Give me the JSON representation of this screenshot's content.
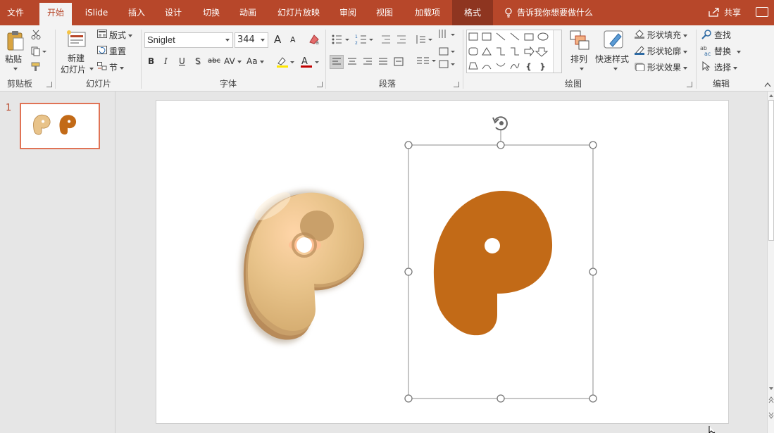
{
  "tabs": [
    {
      "label": "文件",
      "active": false
    },
    {
      "label": "开始",
      "active": true
    },
    {
      "label": "iSlide",
      "active": false
    },
    {
      "label": "插入",
      "active": false
    },
    {
      "label": "设计",
      "active": false
    },
    {
      "label": "切换",
      "active": false
    },
    {
      "label": "动画",
      "active": false
    },
    {
      "label": "幻灯片放映",
      "active": false
    },
    {
      "label": "审阅",
      "active": false
    },
    {
      "label": "视图",
      "active": false
    },
    {
      "label": "加载项",
      "active": false
    },
    {
      "label": "格式",
      "active": false
    }
  ],
  "tell_me": "告诉我你想要做什么",
  "share": "共享",
  "ribbon": {
    "clipboard": {
      "paste": "粘贴",
      "label": "剪贴板"
    },
    "slides": {
      "new_slide_line1": "新建",
      "new_slide_line2": "幻灯片",
      "layout": "版式",
      "reset": "重置",
      "section": "节",
      "label": "幻灯片"
    },
    "font": {
      "name": "Sniglet",
      "size": "344",
      "label": "字体",
      "bold": "B",
      "italic": "I",
      "underline": "U",
      "shadow": "S",
      "strike": "abc",
      "spacing": "AV",
      "case": "Aa",
      "grow": "A",
      "shrink": "A"
    },
    "paragraph": {
      "label": "段落"
    },
    "drawing": {
      "arrange": "排列",
      "quick_styles": "快速样式",
      "fill": "形状填充",
      "outline": "形状轮廓",
      "effects": "形状效果",
      "label": "绘图"
    },
    "editing": {
      "find": "查找",
      "replace": "替换",
      "select": "选择",
      "label": "编辑"
    }
  },
  "thumbnails": [
    {
      "number": "1"
    }
  ],
  "colors": {
    "accent": "#b7472a",
    "letter_flat": "#c26a17",
    "letter_3d": "#e8c38a"
  }
}
